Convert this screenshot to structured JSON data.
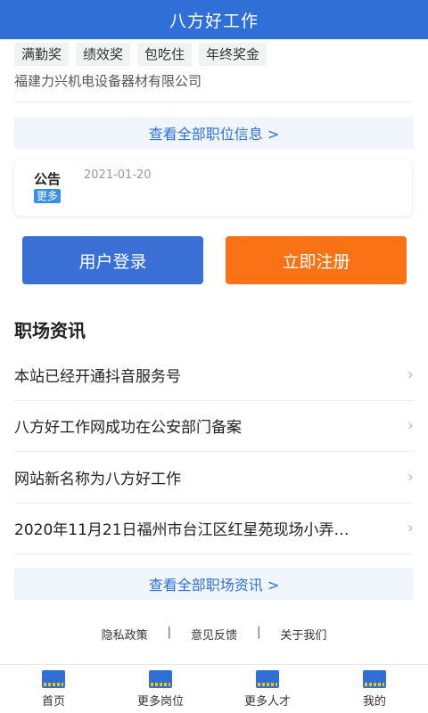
{
  "header": {
    "title": "八方好工作"
  },
  "job": {
    "tags": [
      "满勤奖",
      "绩效奖",
      "包吃住",
      "年终奖金"
    ],
    "company": "福建力兴机电设备器材有限公司",
    "view_all_label": "查看全部职位信息 >"
  },
  "notice": {
    "label": "公告",
    "more_label": "更多",
    "date": "2021-01-20"
  },
  "buttons": {
    "login": "用户登录",
    "register": "立即注册"
  },
  "news": {
    "section_title": "职场资讯",
    "items": [
      "本站已经开通抖音服务号",
      "八方好工作网成功在公安部门备案",
      "网站新名称为八方好工作",
      "2020年11月21日福州市台江区红星苑现场小弄…"
    ],
    "view_all_label": "查看全部职场资讯 >"
  },
  "footer": {
    "privacy": "隐私政策",
    "feedback": "意见反馈",
    "about": "关于我们",
    "separator": "|"
  },
  "nav": {
    "items": [
      "首页",
      "更多岗位",
      "更多人才",
      "我的"
    ]
  },
  "colors": {
    "primary": "#2f6fd6",
    "accent_orange": "#f97316",
    "link_blue": "#2f6fd6",
    "badge_blue": "#3a8ee6"
  },
  "icons": {
    "chevron": "chevron-right-icon",
    "nav_logo": "app-logo-icon"
  }
}
